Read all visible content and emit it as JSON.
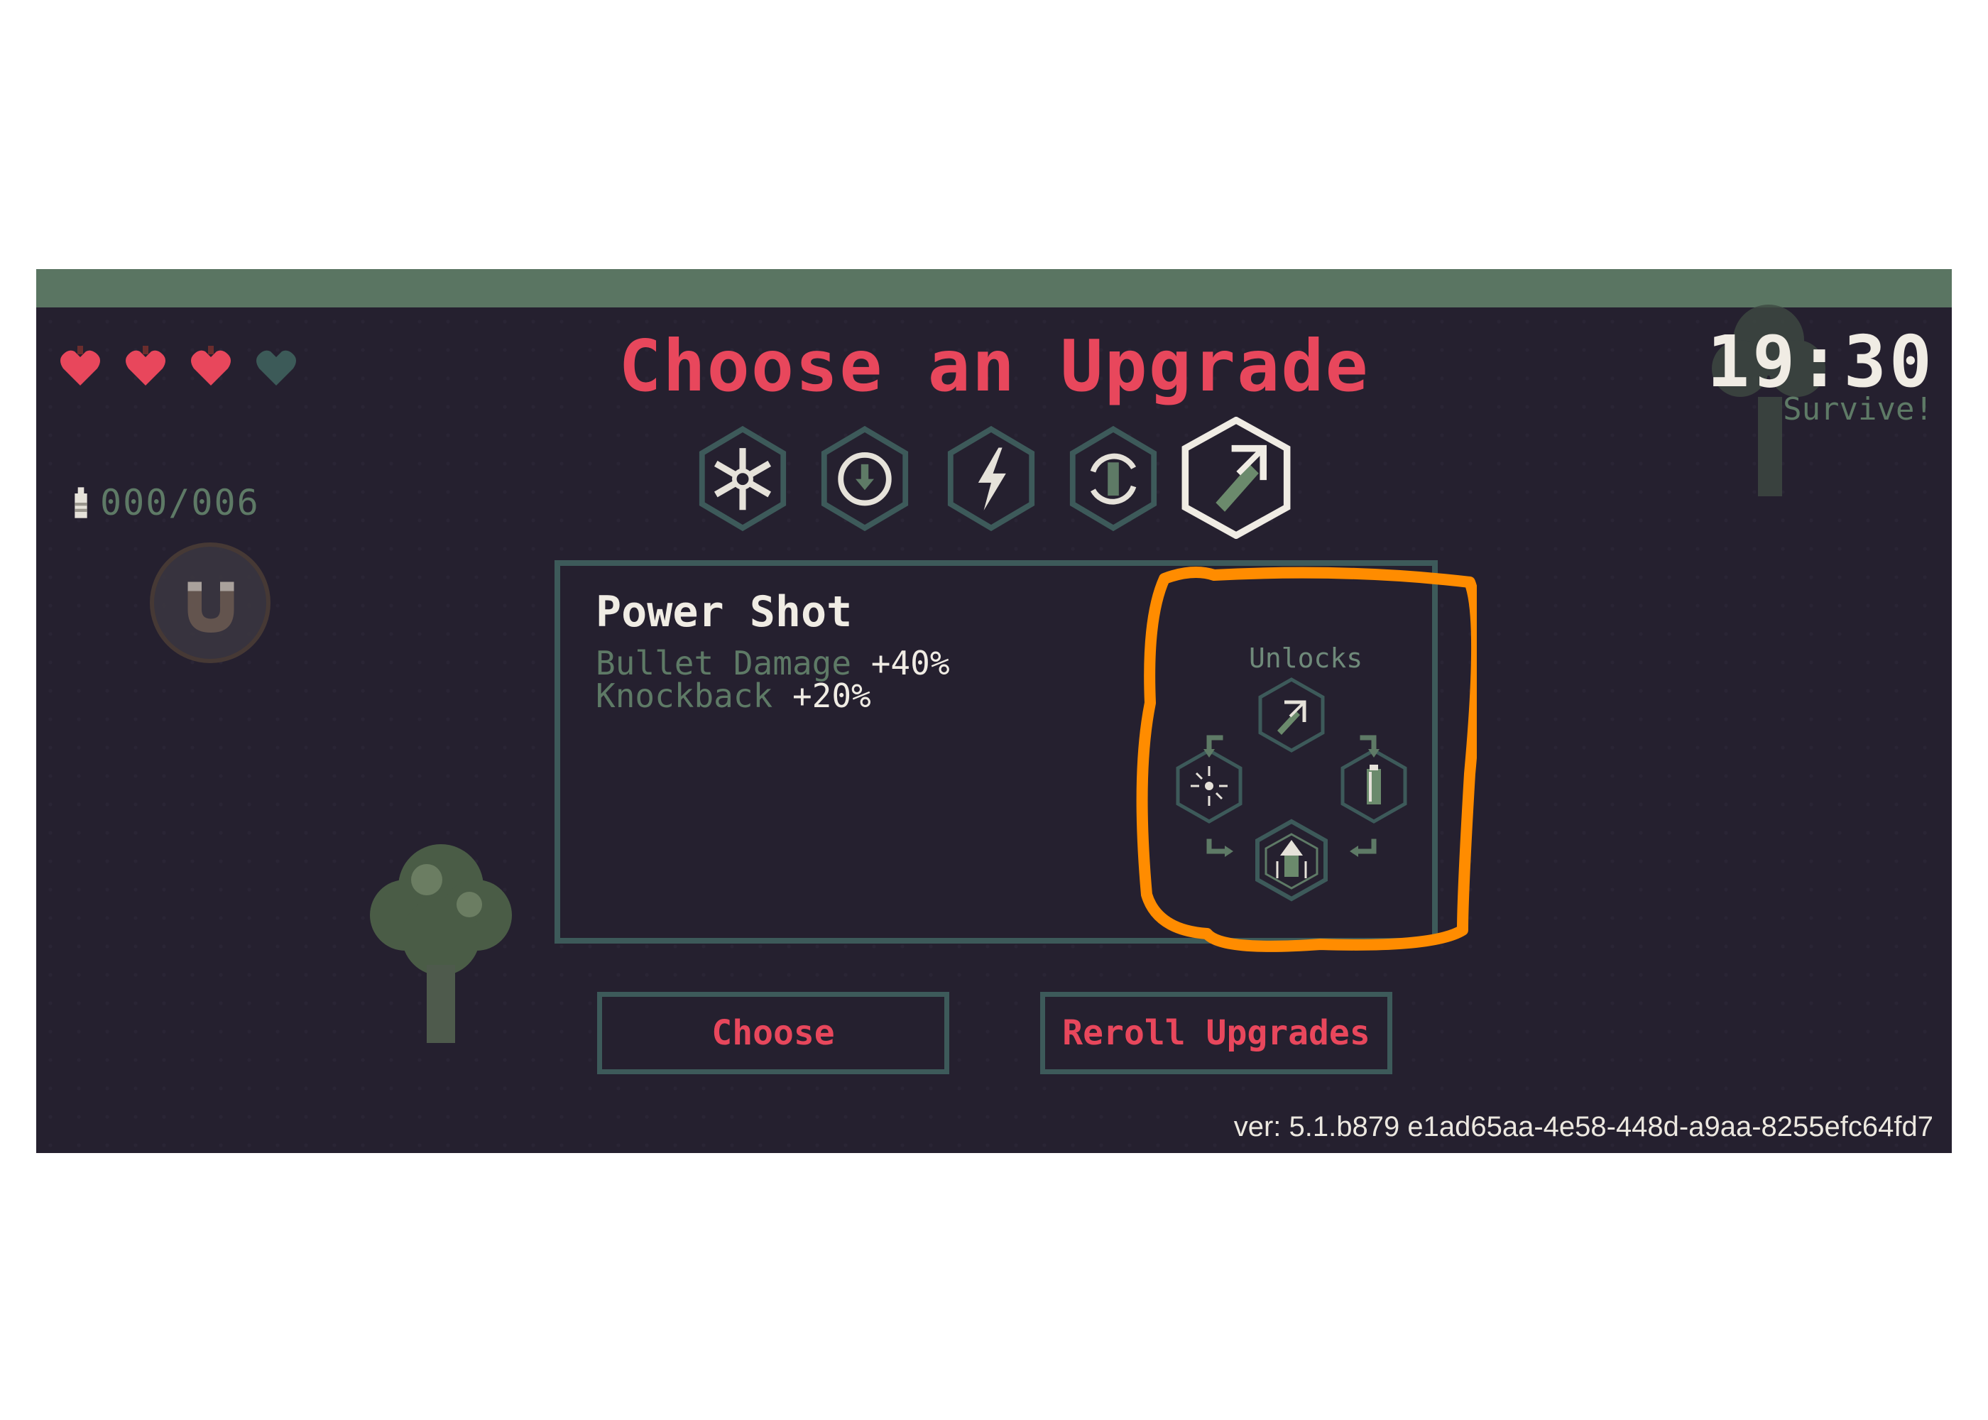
{
  "hud": {
    "hearts": [
      {
        "icon": "heart-full-icon",
        "color": "#e8475c"
      },
      {
        "icon": "heart-full-icon",
        "color": "#e8475c"
      },
      {
        "icon": "heart-full-icon",
        "color": "#e8475c"
      },
      {
        "icon": "heart-empty-icon",
        "color": "#3c5a58"
      }
    ],
    "ammo": "000/006",
    "ammo_icon": "bullet-icon",
    "ability_icon": "magnet-icon",
    "timer": "19:30",
    "objective": "Survive!"
  },
  "screen": {
    "title": "Choose an Upgrade",
    "upgrade_options": [
      {
        "icon": "snowflake-icon",
        "selected": false
      },
      {
        "icon": "target-icon",
        "selected": false
      },
      {
        "icon": "lightning-icon",
        "selected": false
      },
      {
        "icon": "reload-icon",
        "selected": false
      },
      {
        "icon": "power-shot-icon",
        "selected": true
      }
    ]
  },
  "detail": {
    "name": "Power Shot",
    "stats": [
      {
        "label": "Bullet Damage",
        "value": "+40%"
      },
      {
        "label": "Knockback",
        "value": "+20%"
      }
    ],
    "unlocks_label": "Unlocks",
    "unlock_icons": [
      "power-shot-icon",
      "burst-icon",
      "big-bullet-icon",
      "piercing-shot-icon"
    ]
  },
  "buttons": {
    "choose": "Choose",
    "reroll": "Reroll Upgrades"
  },
  "version": "ver: 5.1.b879 e1ad65aa-4e58-448d-a9aa-8255efc64fd7",
  "colors": {
    "accent": "#e8475c",
    "highlight_annotation": "#ff8c00",
    "panel_border": "#3d5a5a",
    "muted_text": "#5e7a66"
  }
}
